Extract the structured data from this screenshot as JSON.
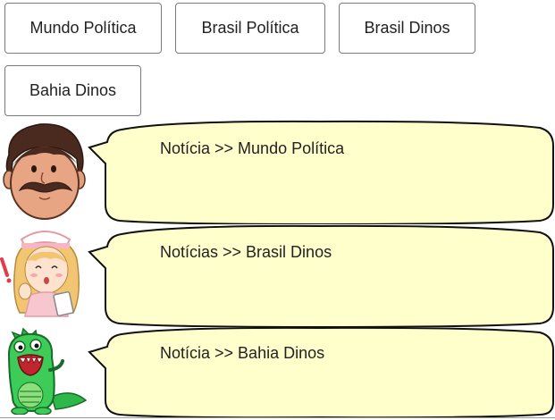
{
  "buttons": [
    {
      "label": "Mundo Política"
    },
    {
      "label": "Brasil Política"
    },
    {
      "label": "Brasil Dinos"
    },
    {
      "label": "Bahia Dinos"
    }
  ],
  "messages": [
    {
      "avatar": "mustache-man-icon",
      "text": "Notícia >> Mundo Política"
    },
    {
      "avatar": "nurse-girl-icon",
      "text": "Notícias >> Brasil Dinos"
    },
    {
      "avatar": "green-dinosaur-icon",
      "text": "Notícia >> Bahia Dinos"
    }
  ],
  "colors": {
    "bubble_fill": "#ffffcc",
    "bubble_border": "#111111",
    "button_border": "#7a7a7a"
  }
}
